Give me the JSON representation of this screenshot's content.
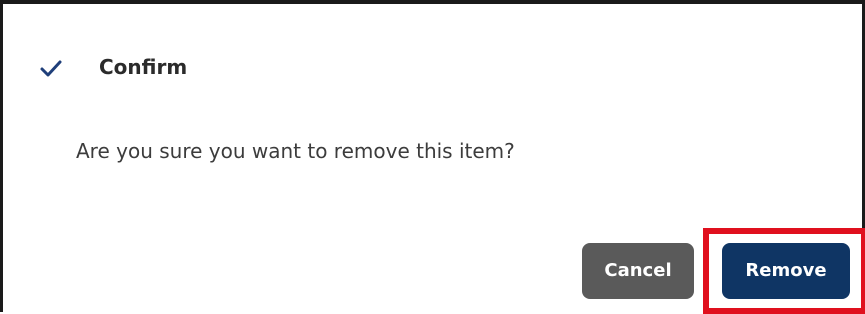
{
  "dialog": {
    "title": "Confirm",
    "title_icon": "check-icon",
    "message": "Are you sure you want to remove this item?"
  },
  "buttons": {
    "cancel_label": "Cancel",
    "remove_label": "Remove"
  },
  "colors": {
    "title_icon": "#1f3f7a",
    "cancel_button": "#5a5a5a",
    "remove_button": "#0f3564",
    "highlight": "#e0101e"
  }
}
